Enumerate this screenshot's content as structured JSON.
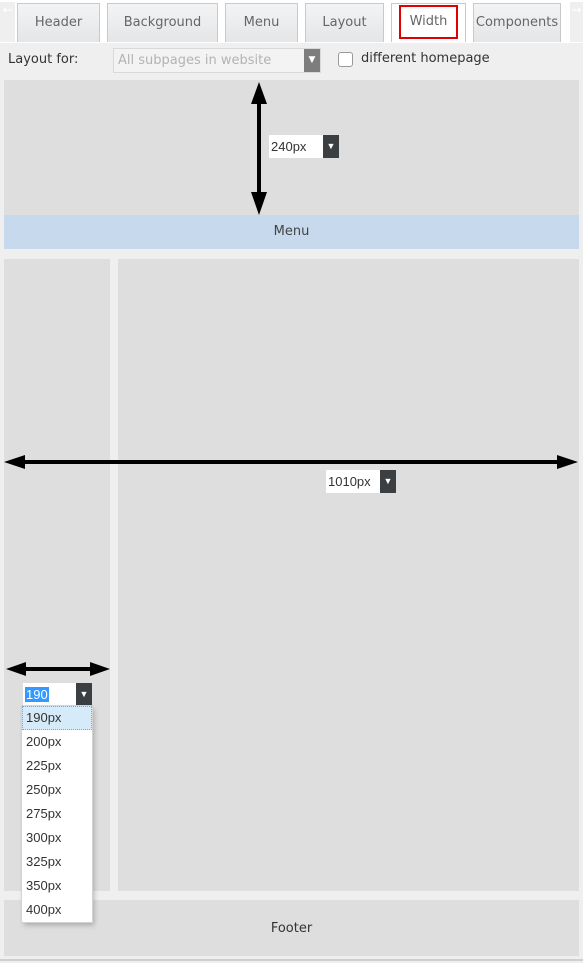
{
  "tabs": {
    "scroll_left_icon": "←",
    "scroll_right_icon": "→",
    "items": [
      {
        "label": "Header"
      },
      {
        "label": "Background"
      },
      {
        "label": "Menu"
      },
      {
        "label": "Layout"
      },
      {
        "label": "Width",
        "active": true
      },
      {
        "label": "Components"
      }
    ],
    "highlight_color": "#e00000"
  },
  "options": {
    "layout_for_label": "Layout for:",
    "layout_for_value": "All subpages in website",
    "different_homepage_label": "different homepage",
    "different_homepage_checked": false
  },
  "layout": {
    "menu_label": "Menu",
    "footer_label": "Footer",
    "header_height": {
      "value": "240px"
    },
    "page_width": {
      "value": "1010px"
    },
    "sidebar_width": {
      "input_value": "190",
      "options": [
        "190px",
        "200px",
        "225px",
        "250px",
        "275px",
        "300px",
        "325px",
        "350px",
        "400px"
      ],
      "selected": "190px"
    }
  },
  "colors": {
    "menu_bg": "#c6d9ed",
    "block_bg": "#dedede",
    "dropdown_arrow_bg": "#3b3f42",
    "selection_bg": "#3399ff"
  }
}
